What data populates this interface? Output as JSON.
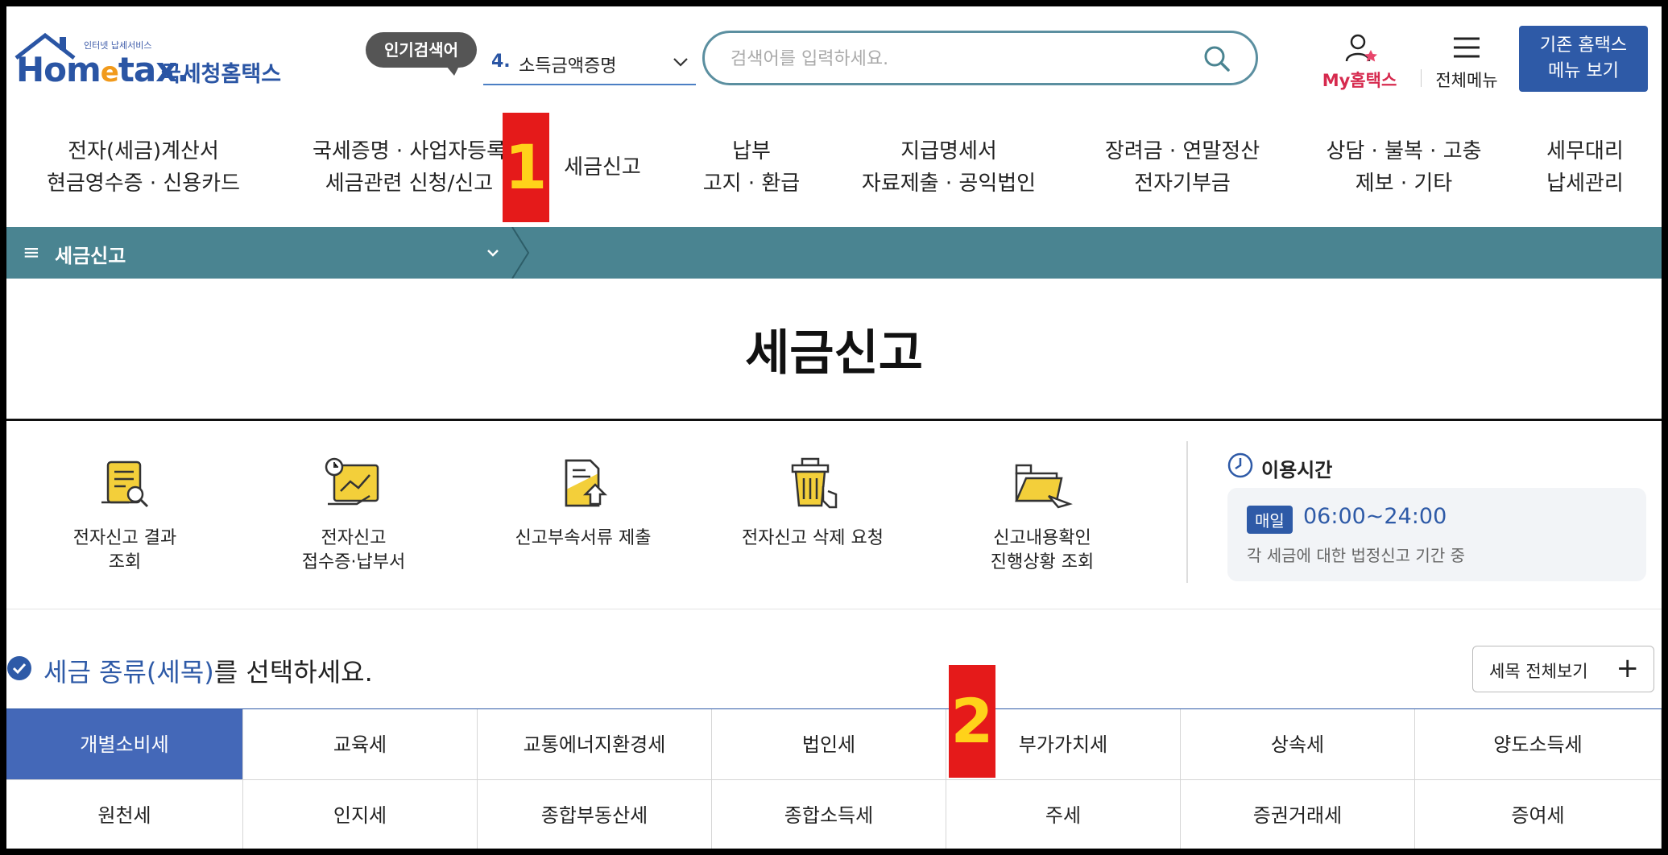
{
  "header": {
    "logo_small": "인터넷 납세서비스",
    "logo_main_pre": "Hom",
    "logo_main_e": "e",
    "logo_main_post": "tax.",
    "logo_ko": "국세청홈택스",
    "popular_badge": "인기검색어",
    "popular_num": "4.",
    "popular_term": "소득금액증명",
    "search_placeholder": "검색어를 입력하세요.",
    "my_hometax": "My홈택스",
    "all_menu": "전체메뉴",
    "old_hometax_line1": "기존 홈택스",
    "old_hometax_line2": "메뉴 보기"
  },
  "nav": [
    {
      "line1": "전자(세금)계산서",
      "line2": "현금영수증 · 신용카드"
    },
    {
      "line1": "국세증명 · 사업자등록",
      "line2": "세금관련 신청/신고"
    },
    {
      "line1": "세금신고",
      "line2": ""
    },
    {
      "line1": "납부",
      "line2": "고지 · 환급"
    },
    {
      "line1": "지급명세서",
      "line2": "자료제출 · 공익법인"
    },
    {
      "line1": "장려금 · 연말정산",
      "line2": "전자기부금"
    },
    {
      "line1": "상담 · 불복 · 고충",
      "line2": "제보 · 기타"
    },
    {
      "line1": "세무대리",
      "line2": "납세관리"
    }
  ],
  "markers": [
    "1",
    "2"
  ],
  "breadcrumb": {
    "menu_icon": "≡",
    "label": "세금신고"
  },
  "page_title": "세금신고",
  "services": [
    {
      "line1": "전자신고 결과",
      "line2": "조회",
      "icon": "scroll-search-icon"
    },
    {
      "line1": "전자신고",
      "line2": "접수증·납부서",
      "icon": "chart-hand-clock-icon"
    },
    {
      "line1": "신고부속서류 제출",
      "line2": "",
      "icon": "document-upload-icon"
    },
    {
      "line1": "전자신고 삭제 요청",
      "line2": "",
      "icon": "trash-click-icon"
    },
    {
      "line1": "신고내용확인",
      "line2": "진행상황 조회",
      "icon": "folder-send-icon"
    }
  ],
  "usage_time": {
    "title": "이용시간",
    "badge": "매일",
    "hours": "06:00~24:00",
    "note": "각 세금에 대한 법정신고 기간 중"
  },
  "tax_select": {
    "title_accent": "세금 종류(세목)",
    "title_rest": "를 선택하세요.",
    "view_all": "세목 전체보기",
    "view_all_icon": "+"
  },
  "tax_types": [
    "개별소비세",
    "교육세",
    "교통에너지환경세",
    "법인세",
    "부가가치세",
    "상속세",
    "양도소득세",
    "원천세",
    "인지세",
    "종합부동산세",
    "종합소득세",
    "주세",
    "증권거래세",
    "증여세"
  ],
  "colors": {
    "brand": "#2e5aa7",
    "bar": "#4a8491",
    "marker_bg": "#e51a1a",
    "marker_fg": "#ffd21a"
  }
}
